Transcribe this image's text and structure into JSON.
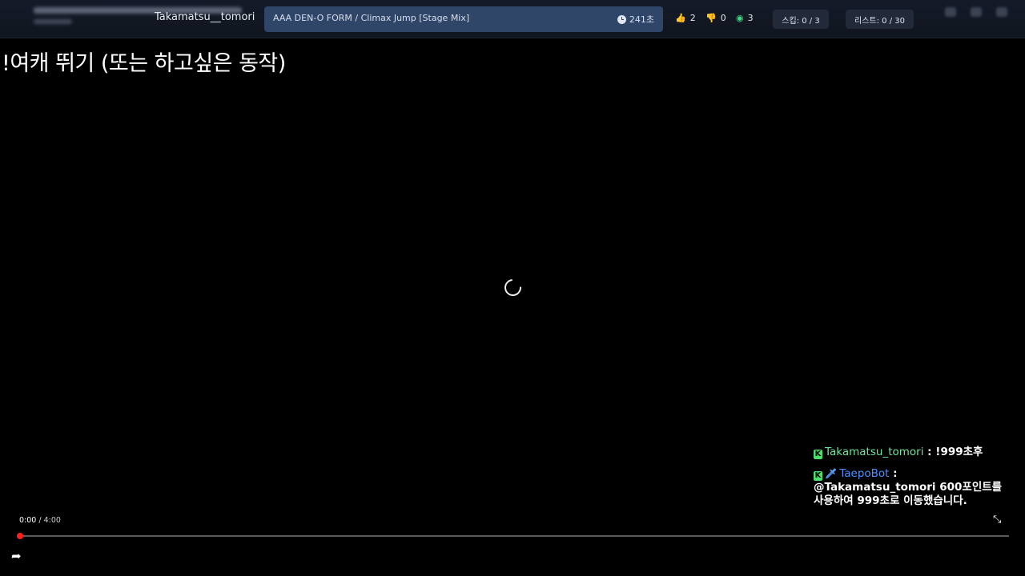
{
  "topbar": {
    "username": "Takamatsu__tomori",
    "song": {
      "title": "AAA DEN-O FORM / Climax Jump [Stage Mix]",
      "duration": "241초"
    },
    "stats": {
      "likes": "2",
      "dislikes": "0",
      "views": "3"
    },
    "skip_pill": "스킵: 0 / 3",
    "list_pill": "리스트: 0 / 30"
  },
  "main": {
    "command_text": "!여캐 뛰기 (또는 하고싶은 동작)"
  },
  "chat": {
    "messages": [
      {
        "name": "Takamatsu_tomori",
        "separator": " : ",
        "text": "!999초후"
      },
      {
        "name": "TaepoBot",
        "separator": " : ",
        "text": "@Takamatsu_tomori 600포인트를 사용하여 999초로 이동했습니다."
      }
    ]
  },
  "player": {
    "current_time": "0:00",
    "time_separator": " / ",
    "total_time": "4:00",
    "progress": 0
  },
  "colors": {
    "song_box": "#2f4669",
    "scrubber": "#ff1f1f",
    "chat_name_1": "#6fe3a0",
    "chat_name_2": "#4f8fff",
    "chat_badge": "#48e06a"
  },
  "icons": {
    "clock": "clock-icon",
    "like": "thumbs-up-icon",
    "dislike": "thumbs-down-icon",
    "views": "eye-icon",
    "chat_badge": "kick-k-icon",
    "bot_badge": "sword-icon",
    "share": "share-icon",
    "expand": "expand-icon",
    "loading": "loading-spinner-icon"
  }
}
